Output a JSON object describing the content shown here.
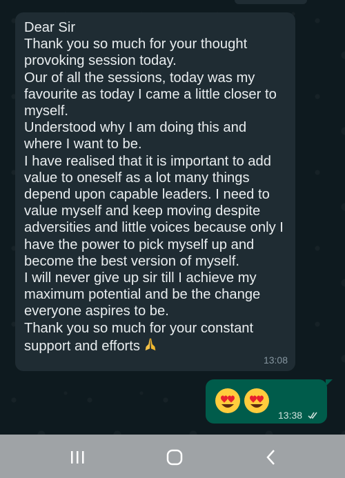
{
  "chat": {
    "incoming": {
      "text": "Dear Sir\nThank you so much for your thought provoking session today.\nOur of all the sessions, today was my favourite as today I came a little closer to myself.\nUnderstood why I am doing this and where I want to be.\nI have realised that it is important to add value to oneself as a lot many things depend upon capable leaders. I need to value myself and keep moving despite adversities and little voices because only I have the power to pick myself up and become the best version of myself.\nI will never give up sir till I achieve my maximum potential and be the change everyone aspires to be.\nThank you so much for your constant support and efforts",
      "emoji_icon": "folded-hands-icon",
      "time": "13:08"
    },
    "outgoing": {
      "emoji_icons": [
        "heart-eyes-icon",
        "heart-eyes-icon"
      ],
      "time": "13:38",
      "status_icon": "double-check-icon"
    }
  },
  "navbar": {
    "buttons": [
      "recent-apps-icon",
      "home-icon",
      "back-icon"
    ]
  },
  "colors": {
    "incoming_bubble": "#1f2c33",
    "outgoing_bubble": "#005c4b",
    "chat_background": "#0e1a1f",
    "navbar": "#9fa3a6",
    "text": "#e9edef",
    "timestamp": "#8696a0"
  }
}
